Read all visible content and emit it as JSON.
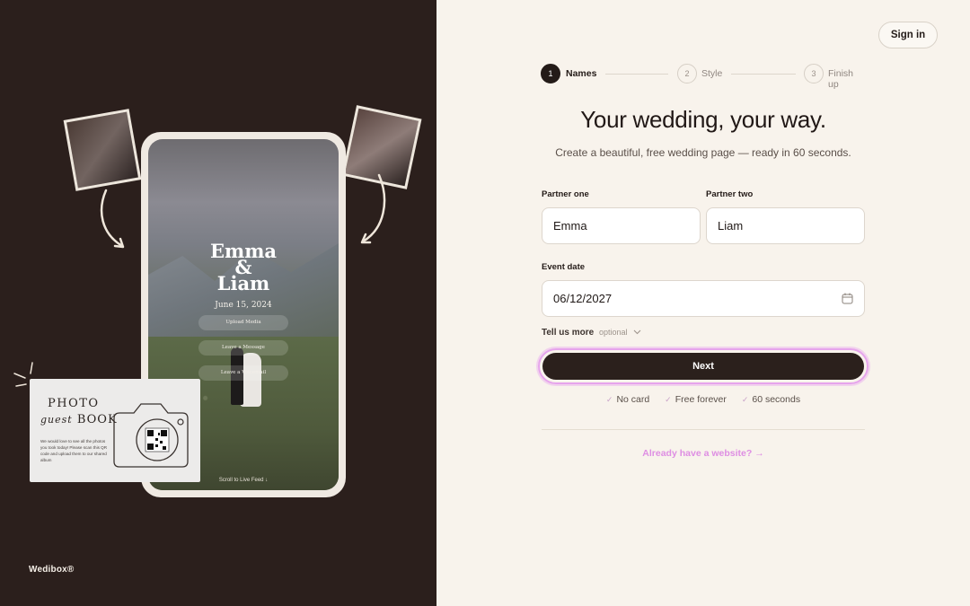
{
  "left": {
    "phone": {
      "names_line1": "Emma",
      "names_line2": "&",
      "names_line3": "Liam",
      "date": "June 15, 2024",
      "buttons": [
        "Upload Media",
        "Leave a Message",
        "Leave a Voicemail"
      ],
      "scroll_note": "Scroll to Live Feed ↓"
    },
    "guestbook": {
      "title_line1": "PHOTO",
      "title_script": "guest",
      "title_line2": "BOOK",
      "body": "We would love to see all the photos you took today! Please scan this QR code and upload them to our shared album"
    },
    "logo": "Wedibox®"
  },
  "header": {
    "signin_label": "Sign in"
  },
  "steps": [
    {
      "number": "1",
      "label": "Names",
      "active": true
    },
    {
      "number": "2",
      "label": "Style",
      "active": false
    },
    {
      "number": "3",
      "label": "Finish up",
      "active": false
    }
  ],
  "hero": {
    "title": "Your wedding, your way.",
    "subtitle": "Create a beautiful, free wedding page — ready in 60 seconds."
  },
  "form": {
    "partner_one_label": "Partner one",
    "partner_one_value": "Emma",
    "partner_two_label": "Partner two",
    "partner_two_value": "Liam",
    "event_date_label": "Event date",
    "event_date_value": "06/12/2027",
    "tell_more_label": "Tell us more",
    "tell_more_optional": "optional",
    "next_label": "Next"
  },
  "perks": [
    "No card",
    "Free forever",
    "60 seconds"
  ],
  "already_link": "Already have a website?",
  "colors": {
    "left_bg": "#2b1f1c",
    "right_bg": "#f8f3ec",
    "primary_button": "#2b201c",
    "accent_pink": "#de8ee3"
  }
}
